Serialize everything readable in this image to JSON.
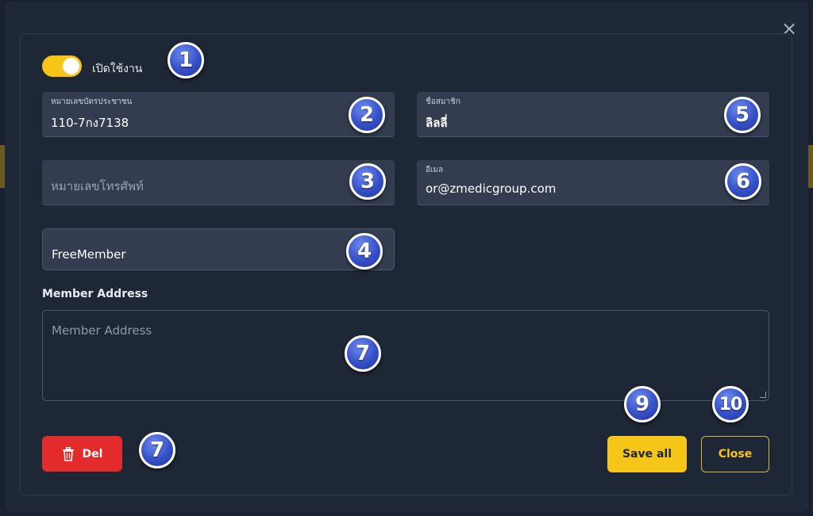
{
  "toggle": {
    "label": "เปิดใช้งาน",
    "checked": true
  },
  "fields": {
    "id_card": {
      "label": "หมายเลขบัตรประชาชน",
      "value": "110-7กง7138"
    },
    "phone": {
      "placeholder": "หมายเลขโทรศัพท์"
    },
    "member_type": {
      "value": "FreeMember"
    },
    "name": {
      "label": "ชื่อสมาชิก",
      "value": "ลิลลี่"
    },
    "email": {
      "label": "อีเมล",
      "value": "or@zmedicgroup.com"
    }
  },
  "address": {
    "label": "Member Address",
    "placeholder": "Member Address"
  },
  "buttons": {
    "del": "Del",
    "save": "Save all",
    "close": "Close"
  },
  "close_icon": "×",
  "badges": [
    "1",
    "2",
    "3",
    "4",
    "5",
    "6",
    "7",
    "7",
    "9",
    "10"
  ],
  "colors": {
    "accent": "#f5c518",
    "danger": "#e32b2b",
    "badge": "#3550c8"
  }
}
